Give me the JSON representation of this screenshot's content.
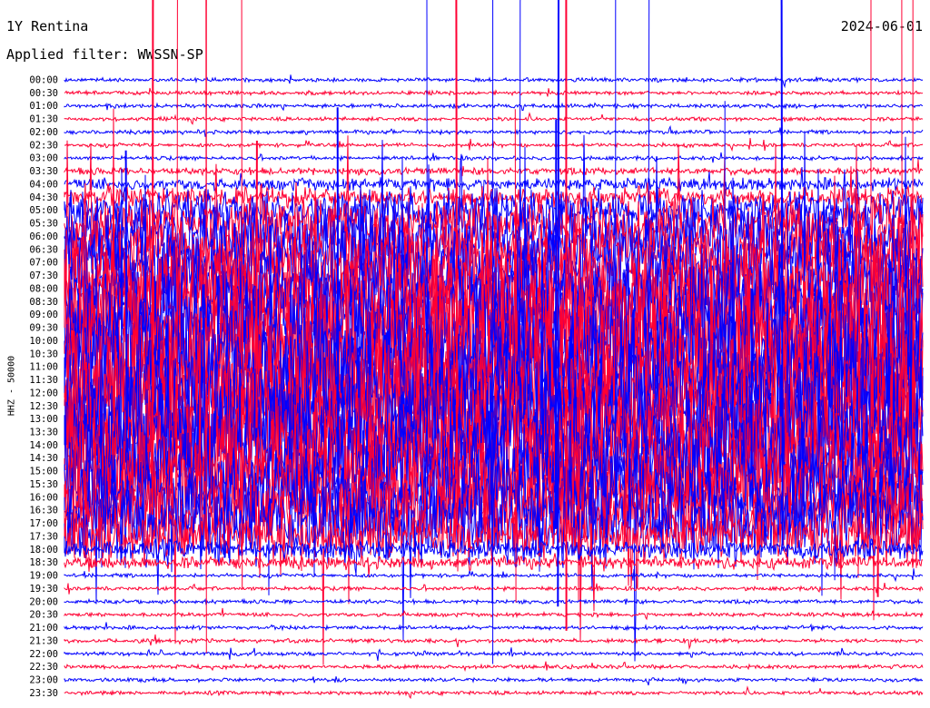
{
  "header": {
    "station": "1Y Rentina",
    "filter": "Applied filter: WWSSN-SP",
    "date": "2024-06-01"
  },
  "axis": {
    "ylabel": "HHZ - 50000"
  },
  "colors": {
    "trace_a": "#0000ff",
    "trace_b": "#ff0033",
    "background": "#ffffff",
    "text": "#000000"
  },
  "chart_data": {
    "type": "line",
    "chart_kind": "helicorder",
    "title": "1Y Rentina",
    "subtitle": "Applied filter: WWSSN-SP",
    "date": "2024-06-01",
    "ylabel": "HHZ - 50000",
    "xlabel": "",
    "grid": false,
    "row_labels": [
      "00:00",
      "00:30",
      "01:00",
      "01:30",
      "02:00",
      "02:30",
      "03:00",
      "03:30",
      "04:00",
      "04:30",
      "05:00",
      "05:30",
      "06:00",
      "06:30",
      "07:00",
      "07:30",
      "08:00",
      "08:30",
      "09:00",
      "09:30",
      "10:00",
      "10:30",
      "11:00",
      "11:30",
      "12:00",
      "12:30",
      "13:00",
      "13:30",
      "14:00",
      "14:30",
      "15:00",
      "15:30",
      "16:00",
      "16:30",
      "17:00",
      "17:30",
      "18:00",
      "18:30",
      "19:00",
      "19:30",
      "20:00",
      "20:30",
      "21:00",
      "21:30",
      "22:00",
      "22:30",
      "23:00",
      "23:30"
    ],
    "row_colors": [
      "trace_a",
      "trace_b"
    ],
    "relative_noise_level": [
      1,
      1,
      1,
      1,
      1,
      1,
      1,
      2,
      3,
      4,
      6,
      7,
      8,
      8,
      9,
      9,
      9,
      10,
      10,
      11,
      11,
      12,
      11,
      11,
      11,
      11,
      11,
      11,
      11,
      10,
      10,
      10,
      9,
      9,
      9,
      7,
      4,
      3,
      1,
      1,
      1,
      1,
      1,
      1,
      1,
      1,
      1,
      1
    ]
  }
}
